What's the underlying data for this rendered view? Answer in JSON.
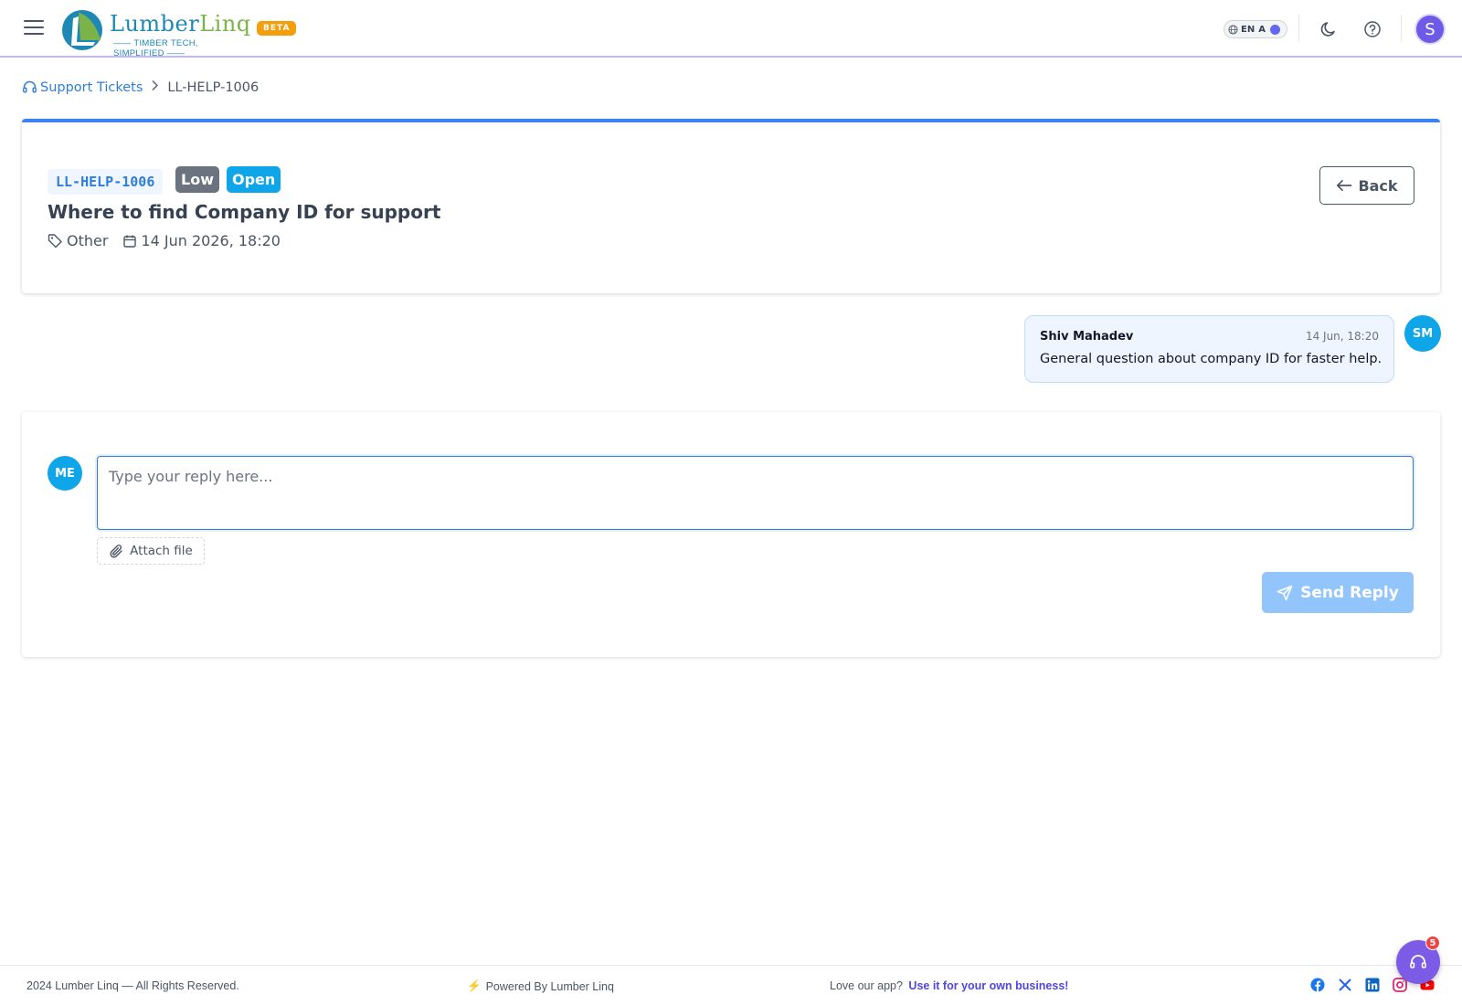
{
  "header": {
    "logo": {
      "word_lumber": "Lumber",
      "word_linq": "Linq",
      "tagline": "—— TIMBER TECH, SIMPLIFIED ——"
    },
    "beta_label": "BETA",
    "language": {
      "code": "EN",
      "script": "A"
    },
    "user_initial": "S"
  },
  "breadcrumb": {
    "parent": "Support Tickets",
    "current": "LL-HELP-1006"
  },
  "ticket": {
    "id": "LL-HELP-1006",
    "priority": "Low",
    "status": "Open",
    "title": "Where to find Company ID for support",
    "category": "Other",
    "created": "14 Jun 2026, 18:20",
    "back_label": "Back"
  },
  "messages": [
    {
      "author": "Shiv Mahadev",
      "time": "14 Jun, 18:20",
      "text": "General question about company ID for faster help.",
      "initials": "SM"
    }
  ],
  "reply": {
    "avatar_initials": "ME",
    "placeholder": "Type your reply here...",
    "value": "",
    "attach_label": "Attach file",
    "send_label": "Send Reply"
  },
  "footer": {
    "copyright": "2024 Lumber Linq — All Rights Reserved.",
    "powered_by": "Powered By Lumber Linq",
    "love_prefix": "Love our app?",
    "love_link": "Use it for your own business!",
    "social": [
      "facebook-icon",
      "x-icon",
      "linkedin-icon",
      "instagram-icon",
      "youtube-icon"
    ]
  },
  "help_fab": {
    "badge_count": "5"
  },
  "colors": {
    "accent": "#2f7fd8",
    "card_top_border": "#3b82f6",
    "badge_low": "#6b7280",
    "badge_open": "#0ea5e9",
    "avatar_user": "#6d5ae6",
    "send_button": "#93c5fd",
    "beta": "#f59e0b"
  }
}
